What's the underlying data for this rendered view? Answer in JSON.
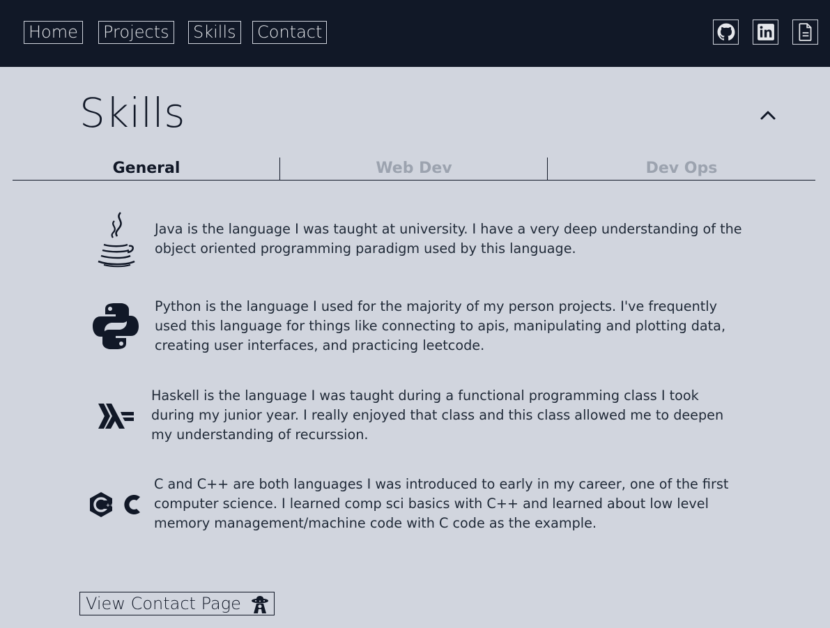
{
  "nav": {
    "items": [
      {
        "label": "Home"
      },
      {
        "label": "Projects"
      },
      {
        "label": "Skills"
      },
      {
        "label": "Contact"
      }
    ],
    "icons": [
      "github-icon",
      "linkedin-icon",
      "resume-document-icon"
    ]
  },
  "section": {
    "title": "Skills",
    "collapse_icon": "chevron-up-icon"
  },
  "tabs": [
    {
      "label": "General",
      "active": true
    },
    {
      "label": "Web Dev",
      "active": false
    },
    {
      "label": "Dev Ops",
      "active": false
    }
  ],
  "skills": [
    {
      "icon": "java-icon",
      "text": "Java is the language I was taught at university. I have a very deep understanding of the object oriented programming paradigm used by this language."
    },
    {
      "icon": "python-icon",
      "text": "Python is the language I used for the majority of my person projects. I've frequently used this language for things like connecting to apis, manipulating and plotting data, creating user interfaces, and practicing leetcode."
    },
    {
      "icon": "haskell-icon",
      "text": "Haskell is the language I was taught during a functional programming class I took during my junior year. I really enjoyed that class and this class allowed me to deepen my understanding of recurssion."
    },
    {
      "icon": "c-cpp-icon",
      "text": "C and C++ are both languages I was introduced to early in my career, one of the first computer science. I learned comp sci basics with C++ and learned about low level memory management/machine code with C code as the example."
    }
  ],
  "cta": {
    "label": "View Contact Page",
    "icon": "ufo-alien-icon"
  },
  "colors": {
    "topbar": "#111827",
    "background": "#d1d5de",
    "text": "#111827",
    "inactive_tab": "#9ca3af"
  }
}
